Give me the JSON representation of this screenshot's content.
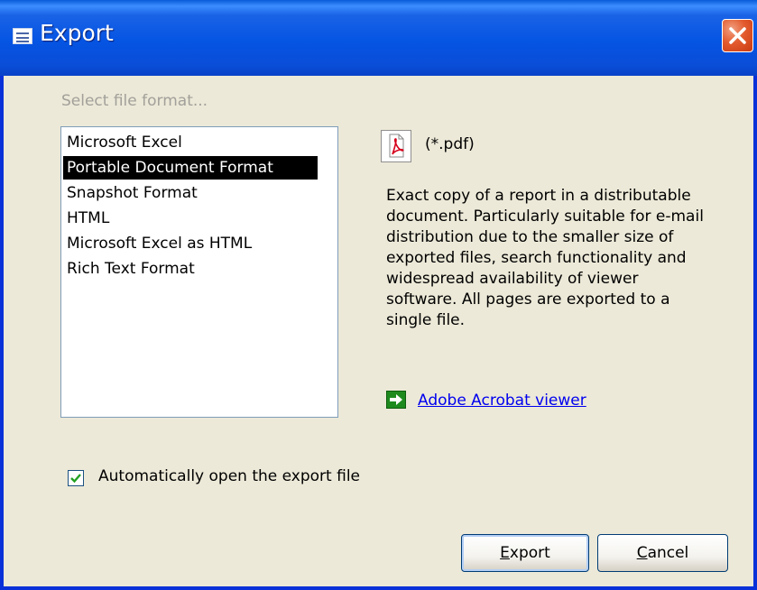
{
  "window": {
    "title": "Export"
  },
  "prompt": "Select file format...",
  "formats": {
    "items": [
      "Microsoft Excel",
      "Portable Document Format",
      "Snapshot Format",
      "HTML",
      "Microsoft Excel as HTML",
      "Rich Text Format"
    ],
    "selected": "Portable Document Format"
  },
  "detail": {
    "icon": "pdf-file-icon",
    "extension": "(*.pdf)",
    "description": "Exact copy of a report in a distributable document. Particularly suitable for e-mail distribution due to the smaller size of exported files, search functionality and widespread availability of viewer software. All pages are exported to a single file.",
    "viewer_icon": "green-arrow-icon",
    "viewer_link": "Adobe Acrobat viewer"
  },
  "options": {
    "auto_open_label": "Automatically open the export file",
    "auto_open_checked": true
  },
  "buttons": {
    "export": {
      "accel": "E",
      "rest": "xport"
    },
    "cancel": {
      "accel": "C",
      "rest": "ancel"
    }
  },
  "colors": {
    "titlebar": "#0A4ED8",
    "dialog_bg": "#ECE9D8",
    "selection_bg": "#000000",
    "link": "#0000EE",
    "close_button": "#E35B2E"
  }
}
